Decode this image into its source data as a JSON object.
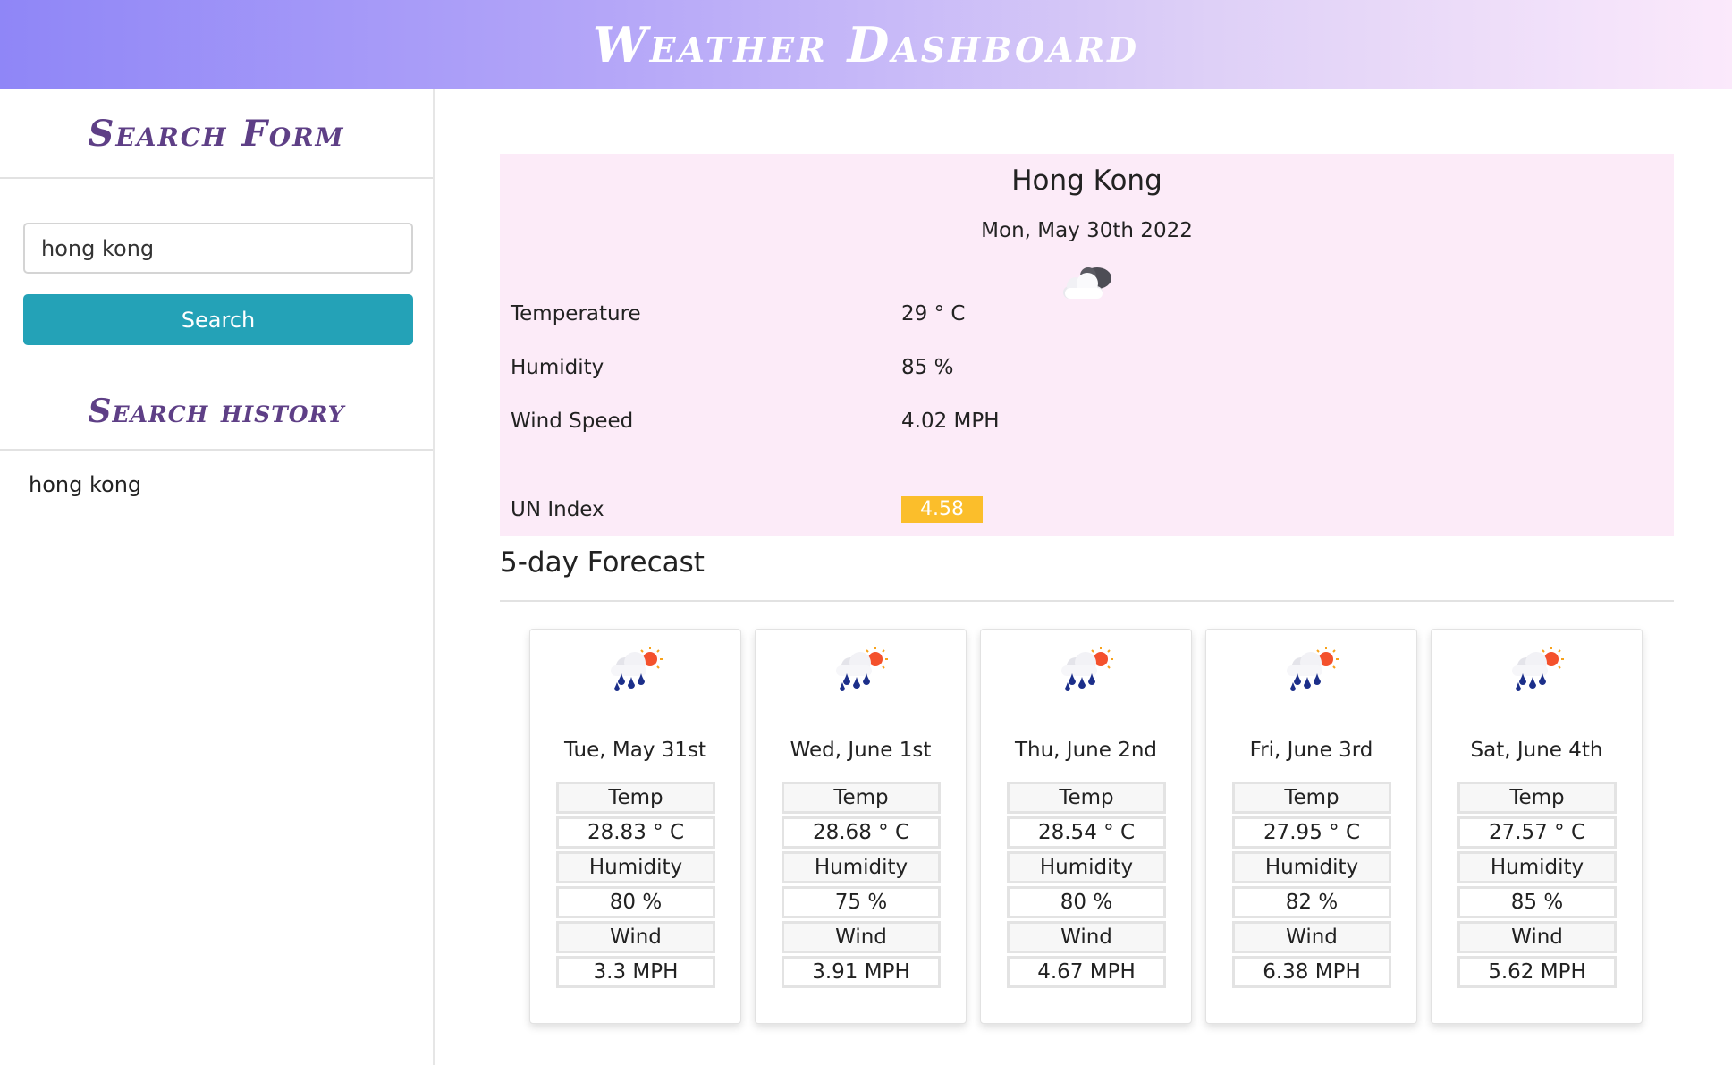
{
  "header": {
    "title": "Weather Dashboard"
  },
  "sidebar": {
    "search_title": "Search Form",
    "search_input_value": "hong kong",
    "search_button_label": "Search",
    "history_title": "Search history",
    "history": [
      "hong kong"
    ]
  },
  "current": {
    "city": "Hong Kong",
    "date": "Mon, May 30th 2022",
    "icon": "cloudy-icon",
    "rows": {
      "temperature": {
        "label": "Temperature",
        "value": "29 ° C"
      },
      "humidity": {
        "label": "Humidity",
        "value": "85 %"
      },
      "wind": {
        "label": "Wind Speed",
        "value": "4.02 MPH"
      },
      "uv": {
        "label": "UN Index",
        "value": "4.58"
      }
    },
    "uv_badge_color": "#fbbe2b"
  },
  "forecast": {
    "title": "5-day Forecast",
    "temp_label": "Temp",
    "humidity_label": "Humidity",
    "wind_label": "Wind",
    "icon": "rain-sun-icon",
    "days": [
      {
        "date": "Tue, May 31st",
        "temp": "28.83 ° C",
        "humidity": "80 %",
        "wind": "3.3 MPH"
      },
      {
        "date": "Wed, June 1st",
        "temp": "28.68 ° C",
        "humidity": "75 %",
        "wind": "3.91 MPH"
      },
      {
        "date": "Thu, June 2nd",
        "temp": "28.54 ° C",
        "humidity": "80 %",
        "wind": "4.67 MPH"
      },
      {
        "date": "Fri, June 3rd",
        "temp": "27.95 ° C",
        "humidity": "82 %",
        "wind": "6.38 MPH"
      },
      {
        "date": "Sat, June 4th",
        "temp": "27.57 ° C",
        "humidity": "85 %",
        "wind": "5.62 MPH"
      }
    ]
  },
  "colors": {
    "accent": "#24a2b7",
    "heading": "#5e3f86",
    "current_bg": "#fcebf8",
    "header_gradient_start": "#8f86f7",
    "header_gradient_end": "#fbe9fb"
  }
}
